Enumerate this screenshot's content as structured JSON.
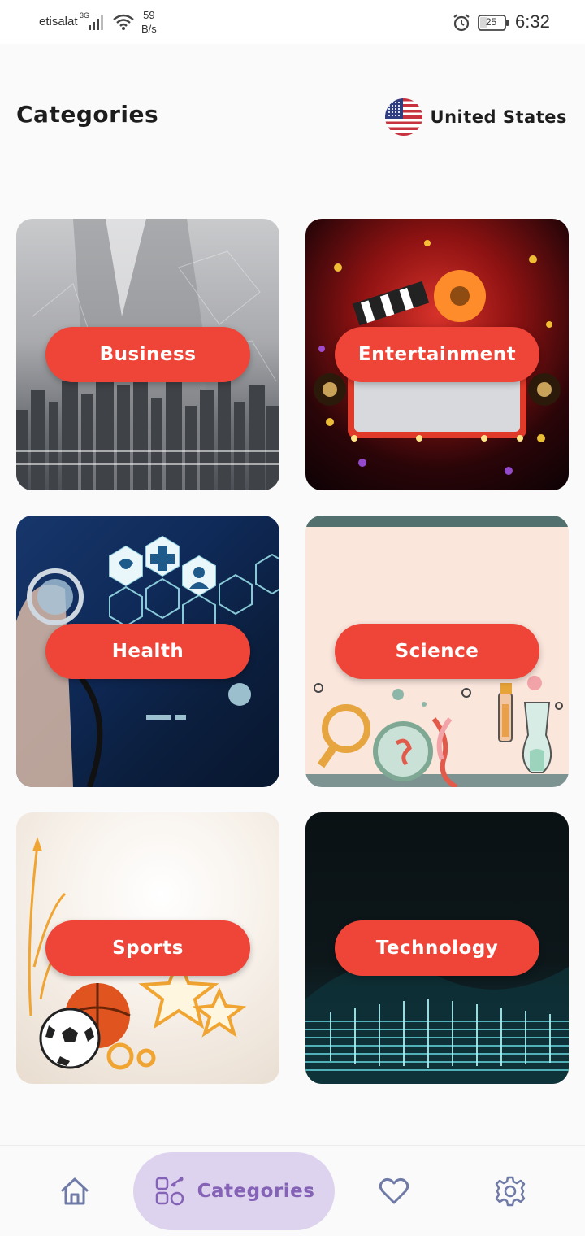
{
  "status_bar": {
    "carrier": "etisalat",
    "network_type": "3G",
    "speed_value": "59",
    "speed_unit": "B/s",
    "battery": "25",
    "time": "6:32"
  },
  "header": {
    "title": "Categories",
    "country": "United States"
  },
  "categories": [
    {
      "label": "Business"
    },
    {
      "label": "Entertainment"
    },
    {
      "label": "Health"
    },
    {
      "label": "Science"
    },
    {
      "label": "Sports"
    },
    {
      "label": "Technology"
    }
  ],
  "bottom_nav": {
    "items": [
      {
        "icon": "home-icon"
      },
      {
        "icon": "categories-icon",
        "label": "Categories",
        "active": true
      },
      {
        "icon": "heart-icon"
      },
      {
        "icon": "gear-icon"
      }
    ]
  },
  "colors": {
    "accent": "#ef4438",
    "nav_active_bg": "#ddd3ee",
    "nav_active_fg": "#8462b6",
    "nav_icon": "#6f7aa6"
  }
}
